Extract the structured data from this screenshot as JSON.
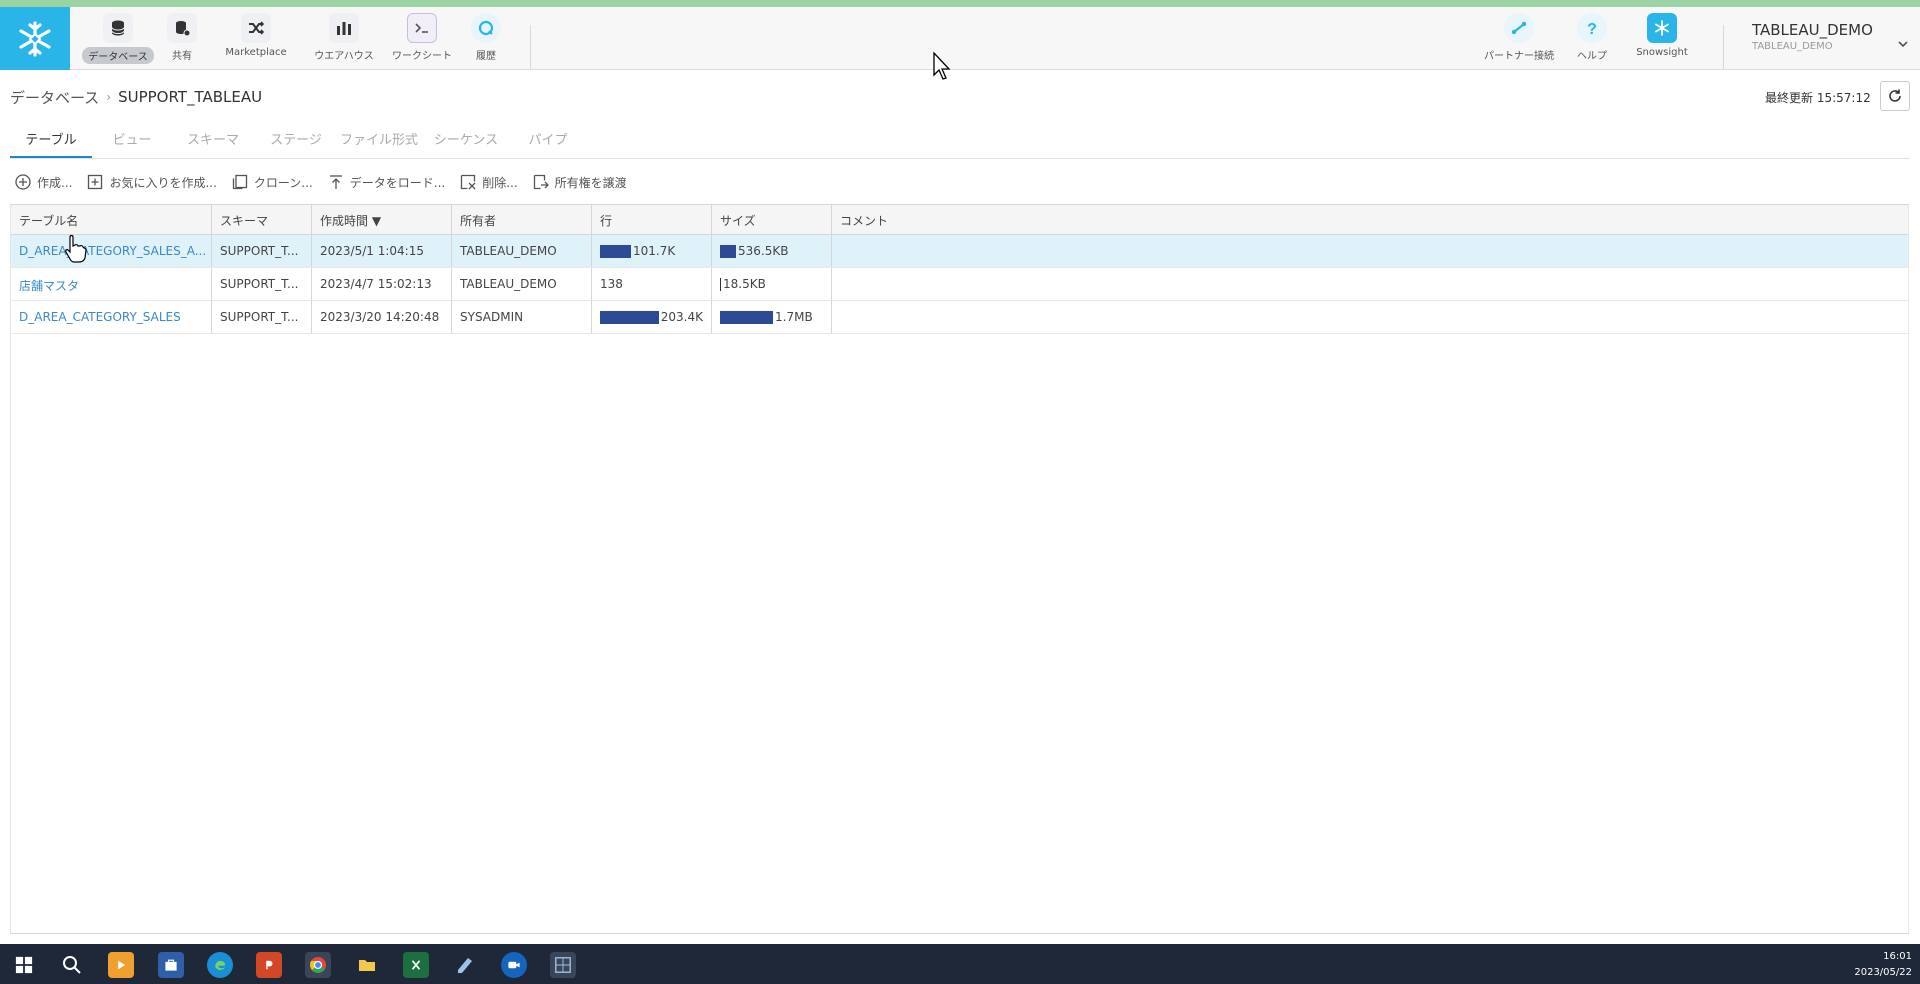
{
  "app": {
    "brand_color": "#29b5e8",
    "accent": "#1e88c9"
  },
  "nav": {
    "items": [
      {
        "label": "データベース",
        "icon": "database-icon",
        "active": true
      },
      {
        "label": "共有",
        "icon": "shares-icon"
      },
      {
        "label": "Marketplace",
        "icon": "marketplace-icon"
      },
      {
        "label": "ウエアハウス",
        "icon": "warehouse-icon"
      },
      {
        "label": "ワークシート",
        "icon": "worksheet-icon"
      },
      {
        "label": "履歴",
        "icon": "history-icon"
      }
    ],
    "right": [
      {
        "label": "パートナー接続",
        "icon": "partner-connect-icon"
      },
      {
        "label": "ヘルプ",
        "icon": "help-icon"
      },
      {
        "label": "Snowsight",
        "icon": "snowsight-icon"
      }
    ],
    "user": {
      "name": "TABLEAU_DEMO",
      "role": "TABLEAU_DEMO"
    }
  },
  "breadcrumb": {
    "parent": "データベース",
    "separator": "›",
    "current": "SUPPORT_TABLEAU"
  },
  "last_update": {
    "label": "最終更新",
    "time": "15:57:12"
  },
  "tabs": [
    "テーブル",
    "ビュー",
    "スキーマ",
    "ステージ",
    "ファイル形式",
    "シーケンス",
    "パイプ"
  ],
  "toolbar": [
    {
      "label": "作成...",
      "icon": "plus-circle-icon"
    },
    {
      "label": "お気に入りを作成...",
      "icon": "add-favorite-icon"
    },
    {
      "label": "クローン...",
      "icon": "clone-icon"
    },
    {
      "label": "データをロード...",
      "icon": "upload-icon"
    },
    {
      "label": "削除...",
      "icon": "delete-icon"
    },
    {
      "label": "所有権を譲渡",
      "icon": "transfer-icon"
    }
  ],
  "table": {
    "columns": [
      "テーブル名",
      "スキーマ",
      "作成時間 ▼",
      "所有者",
      "行",
      "サイズ",
      "コメント"
    ],
    "rows": [
      {
        "name": "D_AREA_CATEGORY_SALES_A...",
        "schema": "SUPPORT_T...",
        "created": "2023/5/1 1:04:15",
        "owner": "TABLEAU_DEMO",
        "rows": "101.7K",
        "rows_fraction": 0.5,
        "size": "536.5KB",
        "size_fraction": 0.31,
        "comment": "",
        "selected": true
      },
      {
        "name": "店舗マスタ",
        "schema": "SUPPORT_T...",
        "created": "2023/4/7 15:02:13",
        "owner": "TABLEAU_DEMO",
        "rows": "138",
        "rows_fraction": 0,
        "size": "18.5KB",
        "size_fraction": 0.01,
        "comment": ""
      },
      {
        "name": "D_AREA_CATEGORY_SALES",
        "schema": "SUPPORT_T...",
        "created": "2023/3/20 14:20:48",
        "owner": "SYSADMIN",
        "rows": "203.4K",
        "rows_fraction": 1,
        "size": "1.7MB",
        "size_fraction": 1,
        "comment": ""
      }
    ]
  },
  "taskbar": {
    "time": "16:01",
    "date": "2023/05/22"
  }
}
